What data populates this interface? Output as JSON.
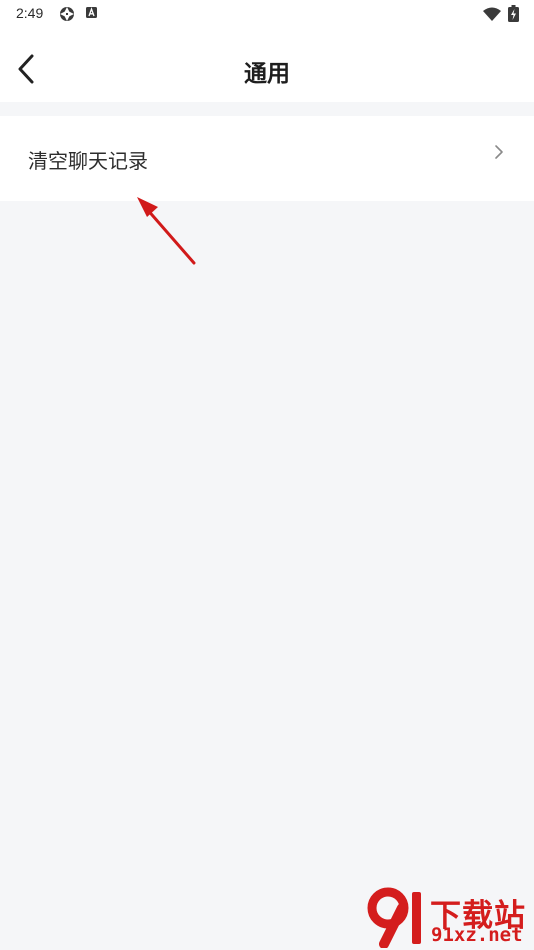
{
  "status_bar": {
    "time": "2:49",
    "icons": [
      "aperture-icon",
      "a-badge-icon",
      "wifi-icon",
      "battery-charging-icon"
    ]
  },
  "header": {
    "title": "通用",
    "back_icon": "chevron-left-icon"
  },
  "settings": {
    "items": [
      {
        "label": "清空聊天记录",
        "icon": "chevron-right-icon"
      }
    ]
  },
  "watermark": {
    "line1": "下载站",
    "line2": "91xz.net",
    "color": "#d41d1d"
  },
  "colors": {
    "background": "#f5f6f8",
    "surface": "#ffffff",
    "annotation": "#d11a1a"
  }
}
